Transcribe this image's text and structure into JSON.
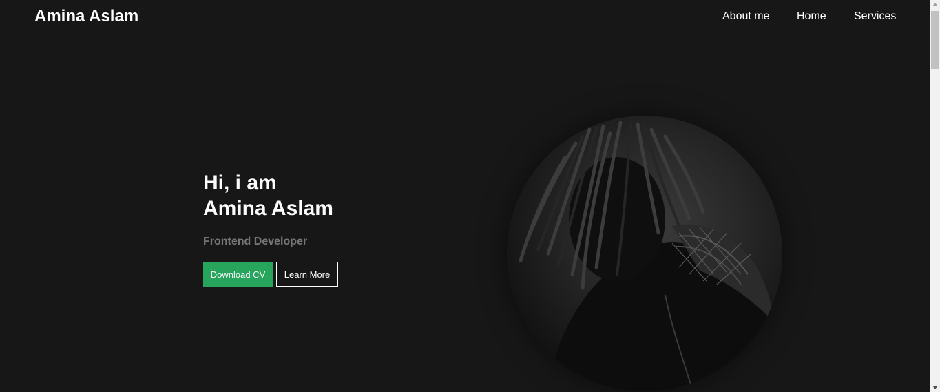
{
  "navbar": {
    "brand": "Amina Aslam",
    "links": [
      {
        "label": "About me"
      },
      {
        "label": "Home"
      },
      {
        "label": "Services"
      }
    ]
  },
  "hero": {
    "greeting": "Hi, i am",
    "name": "Amina Aslam",
    "role": "Frontend Developer",
    "buttons": {
      "download": "Download CV",
      "learn_more": "Learn More"
    }
  },
  "colors": {
    "background": "#171717",
    "accent": "#27a55d",
    "muted_text": "#767676",
    "text": "#ffffff"
  },
  "images": {
    "portrait": "portrait-photo"
  }
}
